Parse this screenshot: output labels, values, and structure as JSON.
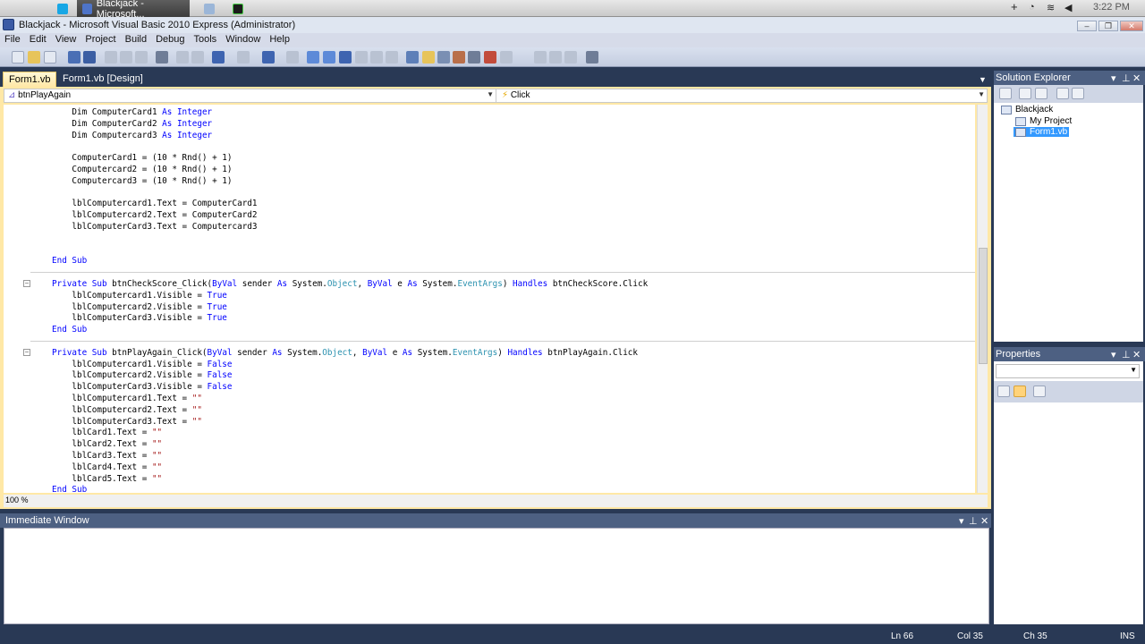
{
  "mac_bar": {
    "tasks": [
      {
        "label": "Blackjack - Microsoft...",
        "active": true
      },
      {
        "label": "",
        "active": false
      },
      {
        "label": "",
        "active": false
      }
    ],
    "time": "3:22 PM"
  },
  "window": {
    "title": "Blackjack - Microsoft Visual Basic 2010 Express (Administrator)"
  },
  "menu": [
    "File",
    "Edit",
    "View",
    "Project",
    "Build",
    "Debug",
    "Tools",
    "Window",
    "Help"
  ],
  "doc_tabs": [
    {
      "label": "Form1.vb",
      "active": true
    },
    {
      "label": "Form1.vb [Design]",
      "active": false
    }
  ],
  "nav": {
    "object": "btnPlayAgain",
    "event": "Click"
  },
  "code": [
    {
      "segs": [
        [
          "    Dim ComputerCard1 ",
          ""
        ],
        [
          "As",
          "kw"
        ],
        [
          " ",
          ""
        ],
        [
          "Integer",
          "kw"
        ]
      ]
    },
    {
      "segs": [
        [
          "    Dim ComputerCard2 ",
          ""
        ],
        [
          "As",
          "kw"
        ],
        [
          " ",
          ""
        ],
        [
          "Integer",
          "kw"
        ]
      ]
    },
    {
      "segs": [
        [
          "    Dim Computercard3 ",
          ""
        ],
        [
          "As",
          "kw"
        ],
        [
          " ",
          ""
        ],
        [
          "Integer",
          "kw"
        ]
      ]
    },
    {
      "segs": []
    },
    {
      "segs": [
        [
          "    ComputerCard1 = (10 * Rnd() + 1)",
          ""
        ]
      ]
    },
    {
      "segs": [
        [
          "    Computercard2 = (10 * Rnd() + 1)",
          ""
        ]
      ]
    },
    {
      "segs": [
        [
          "    Computercard3 = (10 * Rnd() + 1)",
          ""
        ]
      ]
    },
    {
      "segs": []
    },
    {
      "segs": [
        [
          "    lblComputercard1.Text = ComputerCard1",
          ""
        ]
      ]
    },
    {
      "segs": [
        [
          "    lblComputercard2.Text = ComputerCard2",
          ""
        ]
      ]
    },
    {
      "segs": [
        [
          "    lblComputerCard3.Text = Computercard3",
          ""
        ]
      ]
    },
    {
      "segs": []
    },
    {
      "segs": []
    },
    {
      "segs": [
        [
          "End Sub",
          "kw"
        ]
      ]
    },
    {
      "segs": [],
      "sep": true
    },
    {
      "segs": [
        [
          "Private Sub",
          "kw"
        ],
        [
          " btnCheckScore_Click(",
          ""
        ],
        [
          "ByVal",
          "kw"
        ],
        [
          " sender ",
          ""
        ],
        [
          "As",
          "kw"
        ],
        [
          " System.",
          ""
        ],
        [
          "Object",
          "ty"
        ],
        [
          ", ",
          ""
        ],
        [
          "ByVal",
          "kw"
        ],
        [
          " e ",
          ""
        ],
        [
          "As",
          "kw"
        ],
        [
          " System.",
          ""
        ],
        [
          "EventArgs",
          "ty"
        ],
        [
          ") ",
          ""
        ],
        [
          "Handles",
          "kw"
        ],
        [
          " btnCheckScore.Click",
          ""
        ]
      ],
      "fold": true
    },
    {
      "segs": [
        [
          "    lblComputercard1.Visible = ",
          ""
        ],
        [
          "True",
          "kw"
        ]
      ]
    },
    {
      "segs": [
        [
          "    lblComputercard2.Visible = ",
          ""
        ],
        [
          "True",
          "kw"
        ]
      ]
    },
    {
      "segs": [
        [
          "    lblComputerCard3.Visible = ",
          ""
        ],
        [
          "True",
          "kw"
        ]
      ]
    },
    {
      "segs": [
        [
          "End Sub",
          "kw"
        ]
      ]
    },
    {
      "segs": [],
      "sep": true
    },
    {
      "segs": [
        [
          "Private Sub",
          "kw"
        ],
        [
          " btnPlayAgain_Click(",
          ""
        ],
        [
          "ByVal",
          "kw"
        ],
        [
          " sender ",
          ""
        ],
        [
          "As",
          "kw"
        ],
        [
          " System.",
          ""
        ],
        [
          "Object",
          "ty"
        ],
        [
          ", ",
          ""
        ],
        [
          "ByVal",
          "kw"
        ],
        [
          " e ",
          ""
        ],
        [
          "As",
          "kw"
        ],
        [
          " System.",
          ""
        ],
        [
          "EventArgs",
          "ty"
        ],
        [
          ") ",
          ""
        ],
        [
          "Handles",
          "kw"
        ],
        [
          " btnPlayAgain.Click",
          ""
        ]
      ],
      "fold": true
    },
    {
      "segs": [
        [
          "    lblComputercard1.Visible = ",
          ""
        ],
        [
          "False",
          "kw"
        ]
      ]
    },
    {
      "segs": [
        [
          "    lblComputercard2.Visible = ",
          ""
        ],
        [
          "False",
          "kw"
        ]
      ]
    },
    {
      "segs": [
        [
          "    lblComputerCard3.Visible = ",
          ""
        ],
        [
          "False",
          "kw"
        ]
      ]
    },
    {
      "segs": [
        [
          "    lblComputercard1.Text = ",
          ""
        ],
        [
          "\"\"",
          "str"
        ]
      ]
    },
    {
      "segs": [
        [
          "    lblComputercard2.Text = ",
          ""
        ],
        [
          "\"\"",
          "str"
        ]
      ]
    },
    {
      "segs": [
        [
          "    lblComputerCard3.Text = ",
          ""
        ],
        [
          "\"\"",
          "str"
        ]
      ]
    },
    {
      "segs": [
        [
          "    lblCard1.Text = ",
          ""
        ],
        [
          "\"\"",
          "str"
        ]
      ]
    },
    {
      "segs": [
        [
          "    lblCard2.Text = ",
          ""
        ],
        [
          "\"\"",
          "str"
        ]
      ]
    },
    {
      "segs": [
        [
          "    lblCard3.Text = ",
          ""
        ],
        [
          "\"\"",
          "str"
        ]
      ]
    },
    {
      "segs": [
        [
          "    lblCard4.Text = ",
          ""
        ],
        [
          "\"\"",
          "str"
        ]
      ]
    },
    {
      "segs": [
        [
          "    lblCard5.Text = ",
          ""
        ],
        [
          "\"\"",
          "str"
        ]
      ]
    },
    {
      "segs": [
        [
          "End Sub",
          "kw"
        ]
      ]
    }
  ],
  "zoom": "100 %",
  "immediate_window": {
    "title": "Immediate Window"
  },
  "solution_explorer": {
    "title": "Solution Explorer",
    "tree": [
      {
        "label": "Blackjack",
        "selected": false
      },
      {
        "label": "My Project",
        "selected": false
      },
      {
        "label": "Form1.vb",
        "selected": true
      }
    ]
  },
  "properties": {
    "title": "Properties"
  },
  "status": {
    "ln": "Ln 66",
    "col": "Col 35",
    "ch": "Ch 35",
    "mode": "INS"
  },
  "colors": {
    "ide_background": "#293955",
    "active_tab": "#ffe8a6",
    "keyword": "#0000ff",
    "type": "#2b91af",
    "string": "#a31515"
  }
}
